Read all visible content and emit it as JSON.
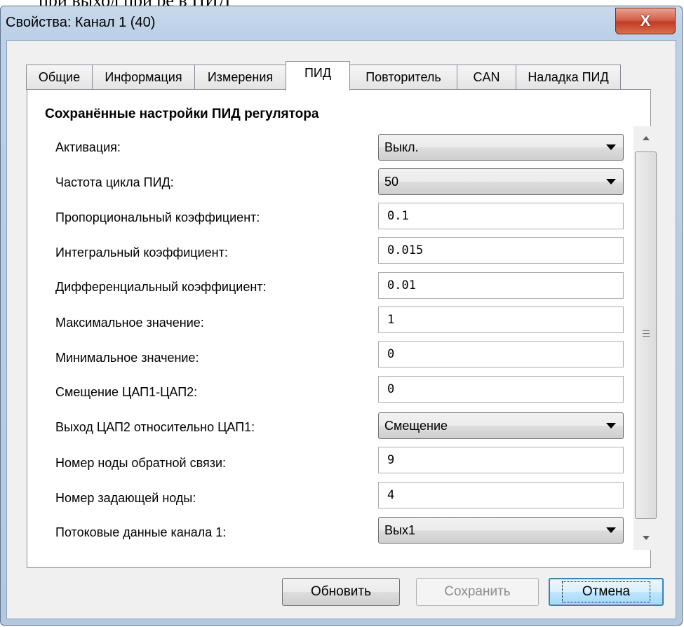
{
  "background_text": "при выход при ре в ПИД",
  "window": {
    "title": "Свойства: Канал 1 (40)",
    "close_glyph": "X"
  },
  "tabs": [
    {
      "label": "Общие"
    },
    {
      "label": "Информация"
    },
    {
      "label": "Измерения"
    },
    {
      "label": "ПИД",
      "active": true
    },
    {
      "label": "Повторитель"
    },
    {
      "label": "CAN"
    },
    {
      "label": "Наладка ПИД"
    }
  ],
  "section": {
    "title": "Сохранённые настройки ПИД регулятора",
    "rows": [
      {
        "label": "Активация:",
        "type": "combo",
        "value": "Выкл."
      },
      {
        "label": "Частота цикла ПИД:",
        "type": "combo",
        "value": "50"
      },
      {
        "label": "Пропорциональный коэффициент:",
        "type": "input",
        "value": "0.1"
      },
      {
        "label": "Интегральный коэффициент:",
        "type": "input",
        "value": "0.015"
      },
      {
        "label": "Дифференциальный коэффициент:",
        "type": "input",
        "value": "0.01"
      },
      {
        "label": "Максимальное значение:",
        "type": "input",
        "value": "1"
      },
      {
        "label": "Минимальное значение:",
        "type": "input",
        "value": "0"
      },
      {
        "label": "Смещение ЦАП1-ЦАП2:",
        "type": "input",
        "value": "0"
      },
      {
        "label": "Выход ЦАП2 относительно ЦАП1:",
        "type": "combo",
        "value": "Смещение"
      },
      {
        "label": "Номер ноды обратной связи:",
        "type": "input",
        "value": "9"
      },
      {
        "label": "Номер задающей ноды:",
        "type": "input",
        "value": "4"
      },
      {
        "label": "Потоковые данные канала 1:",
        "type": "combo",
        "value": "Вых1"
      }
    ]
  },
  "buttons": {
    "refresh": "Обновить",
    "save": "Сохранить",
    "cancel": "Отмена"
  },
  "colors": {
    "frame": "#b9cde5",
    "close_button": "#c9462e",
    "default_button_border": "#3c7fb1"
  }
}
